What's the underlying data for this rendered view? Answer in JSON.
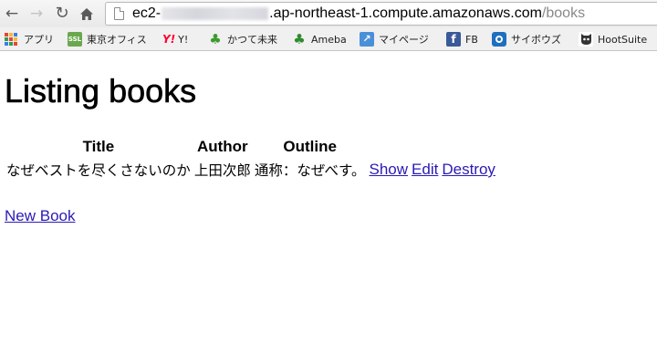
{
  "browser": {
    "url_prefix": "ec2-",
    "url_host_suffix": ".ap-northeast-1.compute.amazonaws.com",
    "url_path": "/books",
    "icons": {
      "back": "back-arrow-icon",
      "forward": "forward-arrow-icon",
      "reload": "reload-icon",
      "home": "home-icon",
      "page": "page-icon"
    }
  },
  "bookmarks": [
    {
      "label": "アプリ",
      "icon": "apps-grid-icon"
    },
    {
      "label": "東京オフィス",
      "icon": "ssl-icon",
      "icon_text": "SSL",
      "color": "#6aa84f"
    },
    {
      "label": "Y!",
      "icon": "yahoo-icon",
      "icon_text": "Y!",
      "color": "#ff0033"
    },
    {
      "label": "かつて未来",
      "icon": "clover-icon",
      "color": "#3d9a2f"
    },
    {
      "label": "Ameba",
      "icon": "ameba-icon",
      "color": "#2e8b2e"
    },
    {
      "label": "マイページ",
      "icon": "mypage-icon",
      "color": "#4a90d9"
    },
    {
      "label": "FB",
      "icon": "facebook-icon",
      "icon_text": "f",
      "color": "#3b5998"
    },
    {
      "label": "サイボウズ",
      "icon": "cybozu-icon",
      "color": "#1f6fbf"
    },
    {
      "label": "HootSuite",
      "icon": "hootsuite-icon",
      "color": "#333333"
    }
  ],
  "page": {
    "title": "Listing books",
    "table": {
      "headers": [
        "Title",
        "Author",
        "Outline"
      ],
      "rows": [
        {
          "title": "なぜベストを尽くさないのか",
          "author": "上田次郎",
          "outline": "通称：なぜべす。",
          "actions": [
            "Show",
            "Edit",
            "Destroy"
          ]
        }
      ]
    },
    "new_book_link": "New Book"
  },
  "colors": {
    "link": "#2a1ab4",
    "toolbar": "#eeeeee"
  }
}
